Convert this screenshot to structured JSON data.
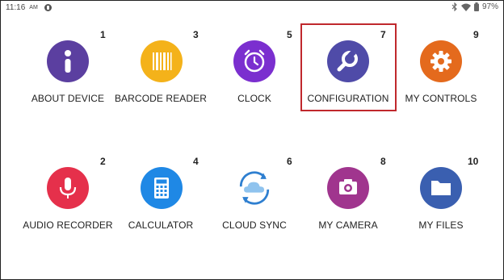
{
  "status_bar": {
    "time": "11:16",
    "ampm": "AM",
    "battery": "97%",
    "icons": [
      "app-notification-icon",
      "bluetooth-icon",
      "wifi-icon",
      "battery-icon"
    ]
  },
  "apps": [
    {
      "number": "1",
      "label": "ABOUT DEVICE",
      "icon": "info-icon",
      "color": "#5b3fa0"
    },
    {
      "number": "3",
      "label": "BARCODE READER",
      "icon": "barcode-icon",
      "color": "#f4b21a"
    },
    {
      "number": "5",
      "label": "CLOCK",
      "icon": "alarm-clock-icon",
      "color": "#7b2fcf"
    },
    {
      "number": "7",
      "label": "CONFIGURATION",
      "icon": "wrench-icon",
      "color": "#4f4ba8"
    },
    {
      "number": "9",
      "label": "MY CONTROLS",
      "icon": "gear-icon",
      "color": "#e46a1d"
    },
    {
      "number": "2",
      "label": "AUDIO RECORDER",
      "icon": "microphone-icon",
      "color": "#e5304b"
    },
    {
      "number": "4",
      "label": "CALCULATOR",
      "icon": "calculator-icon",
      "color": "#1f88e5"
    },
    {
      "number": "6",
      "label": "CLOUD SYNC",
      "icon": "cloud-sync-icon",
      "color": "#3a8fd6"
    },
    {
      "number": "8",
      "label": "MY CAMERA",
      "icon": "camera-icon",
      "color": "#a0358e"
    },
    {
      "number": "10",
      "label": "MY FILES",
      "icon": "folder-icon",
      "color": "#3a5fb0"
    }
  ],
  "highlight": {
    "target": "CONFIGURATION",
    "color": "#c0282d"
  }
}
